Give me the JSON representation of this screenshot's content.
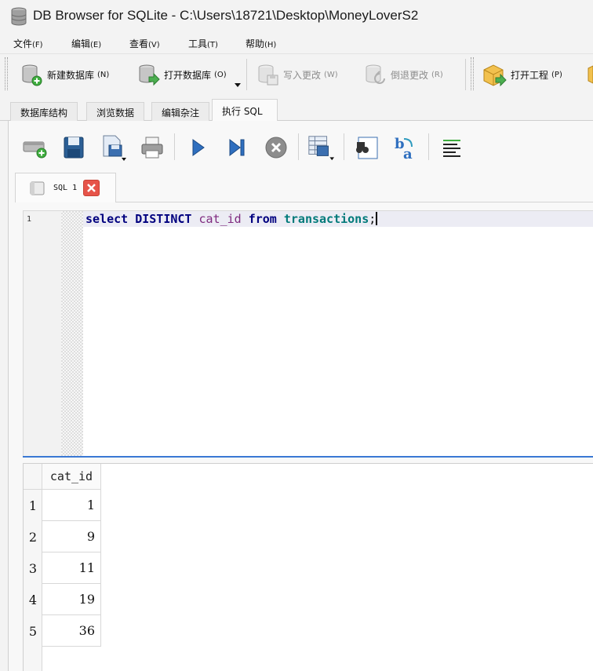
{
  "window": {
    "title": "DB Browser for SQLite - C:\\Users\\18721\\Desktop\\MoneyLoverS2"
  },
  "menu": [
    {
      "label": "文件",
      "accel": "(F)"
    },
    {
      "label": "编辑",
      "accel": "(E)"
    },
    {
      "label": "查看",
      "accel": "(V)"
    },
    {
      "label": "工具",
      "accel": "(T)"
    },
    {
      "label": "帮助",
      "accel": "(H)"
    }
  ],
  "toolbar": {
    "new_db": {
      "label": "新建数据库",
      "accel": "(N)"
    },
    "open_db": {
      "label": "打开数据库",
      "accel": "(O)"
    },
    "write_changes": {
      "label": "写入更改",
      "accel": "(W)"
    },
    "revert_changes": {
      "label": "倒退更改",
      "accel": "(R)"
    },
    "open_project": {
      "label": "打开工程",
      "accel": "(P)"
    }
  },
  "tabs": [
    {
      "label": "数据库结构"
    },
    {
      "label": "浏览数据"
    },
    {
      "label": "编辑杂注"
    },
    {
      "label": "执行 SQL",
      "active": true
    }
  ],
  "sql_tab": {
    "label": "SQL 1"
  },
  "editor": {
    "line_number": "1",
    "tokens": [
      "select",
      "DISTINCT",
      "cat_id",
      "from",
      "transactions",
      ";"
    ]
  },
  "results": {
    "columns": [
      "cat_id"
    ],
    "row_numbers": [
      "1",
      "2",
      "3",
      "4",
      "5"
    ],
    "rows": [
      [
        "1"
      ],
      [
        "9"
      ],
      [
        "11"
      ],
      [
        "19"
      ],
      [
        "36"
      ]
    ]
  },
  "colors": {
    "keyword": "#00007f",
    "identifier": "#7f2b7f",
    "table": "#007a7a",
    "splitter": "#3a78d4",
    "close_button": "#e6544a"
  }
}
